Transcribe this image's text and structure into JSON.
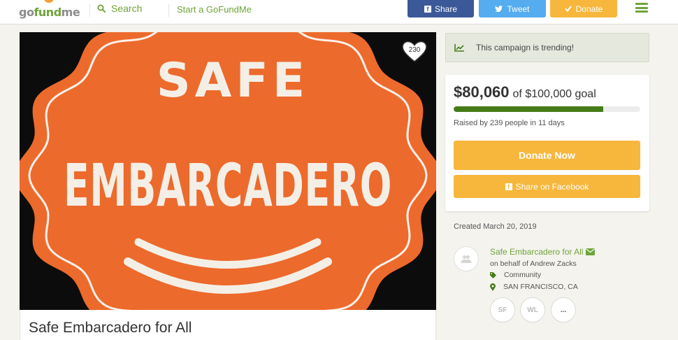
{
  "header": {
    "logo": {
      "go": "go",
      "fund": "fund",
      "me": "me"
    },
    "search_label": "Search",
    "start_link": "Start a GoFundMe",
    "share_label": "Share",
    "tweet_label": "Tweet",
    "donate_label": "Donate"
  },
  "hero": {
    "image_text_top": "SAFE",
    "image_text_main": "EMBARCADERO",
    "favorite_count": "230"
  },
  "campaign": {
    "title": "Safe Embarcadero for All"
  },
  "sidebar": {
    "trending_text": "This campaign is trending!",
    "amount_raised": "$80,060",
    "goal_text": "of $100,000 goal",
    "progress_fraction": 0.8006,
    "raised_by": "Raised by 239 people in 11 days",
    "donate_now_label": "Donate Now",
    "share_facebook_label": "Share on Facebook",
    "created": "Created March 20, 2019",
    "organizer": {
      "name": "Safe Embarcadero for All",
      "on_behalf": "on behalf of Andrew Zacks",
      "category": "Community",
      "location": "SAN FRANCISCO, CA"
    },
    "team_initials": [
      "SF",
      "WL",
      "..."
    ]
  },
  "colors": {
    "brand_green": "#6fa43a",
    "progress_green": "#457c17",
    "donate_yellow": "#f6b73c",
    "facebook_blue": "#3b5998",
    "twitter_blue": "#55acee",
    "hero_orange": "#ec6a2c"
  }
}
